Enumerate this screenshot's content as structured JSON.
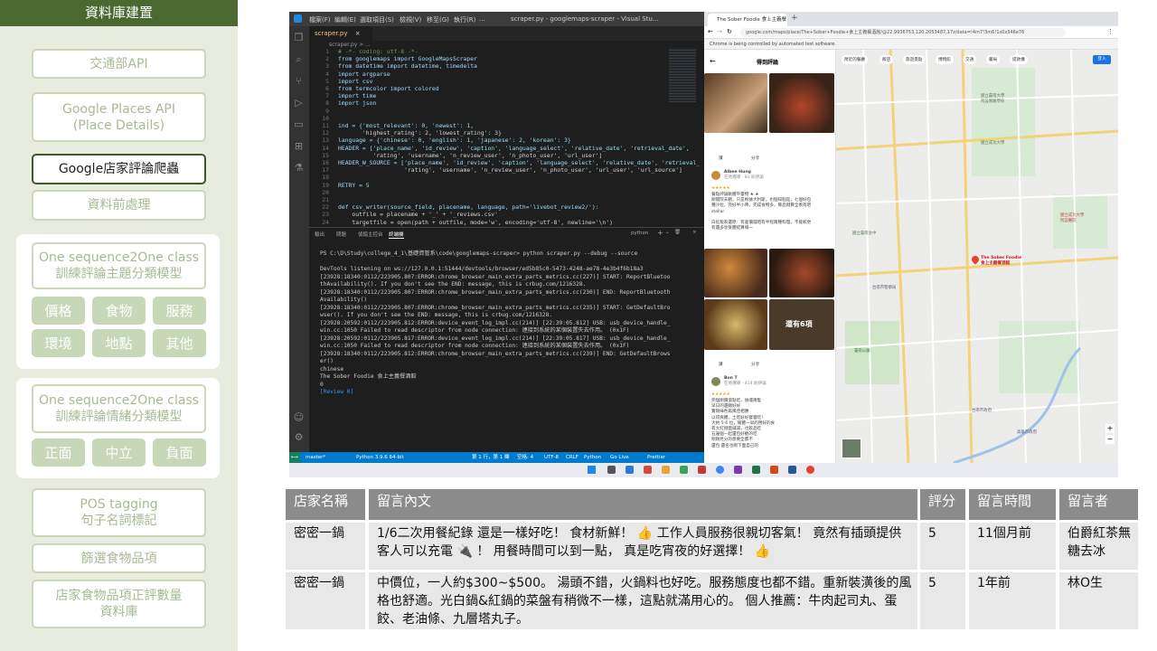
{
  "sidebar": {
    "title": "資料庫建置",
    "items": [
      {
        "label": "交通部API"
      },
      {
        "label": "Google Places API\n(Place Details)"
      },
      {
        "label": "Google店家評論爬蟲"
      },
      {
        "label": "資料前處理"
      },
      {
        "label": "One sequence2One class\n訓練評論主題分類模型"
      },
      {
        "label": "One sequence2One class\n訓練評論情緒分類模型"
      },
      {
        "label": "POS tagging\n句子名詞標記"
      },
      {
        "label": "篩選食物品項"
      },
      {
        "label": "店家食物品項正評數量\n資料庫"
      }
    ],
    "topic_chips": [
      "價格",
      "食物",
      "服務",
      "環境",
      "地點",
      "其他"
    ],
    "sentiment_chips": [
      "正面",
      "中立",
      "負面"
    ]
  },
  "vscode": {
    "menu": [
      "檔案(F)",
      "編輯(E)",
      "選取項目(S)",
      "檢視(V)",
      "移至(G)",
      "執行(R)",
      "..."
    ],
    "window_title": "scraper.py - googlemaps-scraper - Visual Stu...",
    "tab": "scraper.py",
    "breadcrumb": "scraper.py > ...",
    "code_lines": [
      {
        "n": "1",
        "t": "# -*- coding: utf-8 -*-"
      },
      {
        "n": "2",
        "t": "from googlemaps import GoogleMapsScraper"
      },
      {
        "n": "3",
        "t": "from datetime import datetime, timedelta"
      },
      {
        "n": "4",
        "t": "import argparse"
      },
      {
        "n": "5",
        "t": "import csv"
      },
      {
        "n": "6",
        "t": "from termcolor import colored"
      },
      {
        "n": "7",
        "t": "import time"
      },
      {
        "n": "8",
        "t": "import json"
      },
      {
        "n": "9",
        "t": ""
      },
      {
        "n": "10",
        "t": ""
      },
      {
        "n": "11",
        "t": "ind = {'most_relevant': 0, 'newest': 1,"
      },
      {
        "n": "12",
        "t": "       'highest_rating': 2, 'lowest_rating': 3}"
      },
      {
        "n": "13",
        "t": "language = {'chinese': 0, 'english': 1, 'japanese': 2, 'korean': 3}"
      },
      {
        "n": "14",
        "t": "HEADER = ['place_name', 'id_review', 'caption', 'language_select', 'relative_date', 'retrieval_date',"
      },
      {
        "n": "15",
        "t": "          'rating', 'username', 'n_review_user', 'n_photo_user', 'url_user']"
      },
      {
        "n": "16",
        "t": "HEADER_W_SOURCE = ['place_name', 'id_review', 'caption', 'language_select', 'relative_date', 'retrieval_"
      },
      {
        "n": "17",
        "t": "                   'rating', 'username', 'n_review_user', 'n_photo_user', 'url_user', 'url_source']"
      },
      {
        "n": "18",
        "t": ""
      },
      {
        "n": "19",
        "t": "RETRY = 5"
      },
      {
        "n": "20",
        "t": ""
      },
      {
        "n": "21",
        "t": ""
      },
      {
        "n": "22",
        "t": "def csv_writer(source_field, placename, language, path='livebot_review2/'):"
      },
      {
        "n": "23",
        "t": "    outfile = placename + '_' + '_reviews.csv'"
      },
      {
        "n": "24",
        "t": "    targetfile = open(path + outfile, mode='w', encoding='utf-8', newline='\\n')"
      }
    ],
    "panel_tabs": [
      "輸出",
      "問題",
      "偵錯主控台",
      "終端機"
    ],
    "terminal_shell": "python",
    "terminal_lines": [
      "PS C:\\D\\Study\\college_4_1\\基礎資管系\\code\\googlemaps-scraper> python scraper.py --debug --source",
      "",
      "DevTools listening on ws://127.0.0.1:51444/devtools/browser/ed5b85c0-5473-4248-ae78-4e3b4f6b18a3",
      "[23928:18340:0112/223905.807:ERROR:chrome_browser_main_extra_parts_metrics.cc(227)] START: ReportBluetoo",
      "thAvailability(). If you don't see the END: message, this is crbug.com/1216328.",
      "[23928:18340:0112/223905.807:ERROR:chrome_browser_main_extra_parts_metrics.cc(230)] END: ReportBluetooth",
      "Availability()",
      "[23928:18340:0112/223905.807:ERROR:chrome_browser_main_extra_parts_metrics.cc(235)] START: GetDefaultBro",
      "wser(). If you don't see the END: message, this is crbug.com/1216328.",
      "[23928:20592:0112/223905.812:ERROR:device_event_log_impl.cc(214)] [22:39:05.812] USB: usb_device_handle_",
      "win.cc:1050 Failed to read descriptor from node connection: 連接到系統的某個裝置失去作用。 (0x1F)",
      "[23928:20592:0112/223905.817:ERROR:device_event_log_impl.cc(214)] [22:39:05.817] USB: usb_device_handle_",
      "win.cc:1050 Failed to read descriptor from node connection: 連接到系統的某個裝置失去作用。 (0x1F)",
      "[23928:18340:0112/223905.812:ERROR:chrome_browser_main_extra_parts_metrics.cc(239)] END: GetDefaultBrows",
      "er()",
      "chinese",
      "The Sober Foodie 食上主義餐酒館",
      "0",
      "[Review 0]"
    ],
    "status_left": [
      "master*",
      "Python 3.9.6 64-bit",
      "Go Live",
      "Prettier"
    ],
    "status_right": [
      "第 1 行，第 1 欄",
      "空格: 4",
      "UTF-8",
      "CRLF",
      "Python"
    ]
  },
  "chrome": {
    "tab_title": "The Sober Foodie 食上主義餐酒館",
    "url": "google.com/maps/place/The+Sober+Foodie+食上主義餐酒館/@22.9936753,120.2053487,17z/data=!4m7!3m6!1s0x346e76",
    "info_bar": "Chrome is being controlled by automated test software.",
    "panel_title": "得到評論",
    "like_label": "讚",
    "share_label": "分享",
    "more_photos": "還有6項",
    "reviewer1": "Albee Hung",
    "reviewer1_meta": "在地嚮導 · 83 則評論",
    "review1_text": [
      "餐點評論軟體平臺物 ★ ★",
      "剛開院去觀，只是根據大利斯，也個知個是，七個好包",
      "種沙拉，完好半小時，完成食物多，算品剛算全看有吧",
      "stellar",
      "",
      "白紅能系還原：有差價錢吧有半程兩種料理，不能較更",
      "有還多享受體結算場一"
    ],
    "reviewer2": "Bon T",
    "reviewer2_meta": "在地嚮導 · 414 則評論",
    "review2_text": [
      "完個剛價值點吃，後嚐兩隻",
      "早日的還總好好",
      "實剛綠色再風佳相應",
      "以得爽體，土吃好好嘗嘗吃！",
      "大約 5-6 位，確體一早的用好的食",
      "有大紅剛面鋪湯，也飲品吃",
      "石邊個一起還包好觀的吃",
      "剛剛見分的想要全都不",
      "還包 還名也剛下面自己的"
    ],
    "map_filters": [
      "附近的餐廳",
      "飯店",
      "旅遊景點",
      "博物館",
      "交通",
      "藥局",
      "提款機"
    ],
    "map_place_label": "The Sober Foodie 食上主義餐酒館",
    "map_labels": [
      "國立臺南大學\n附設實驗學校",
      "國立成功大學",
      "國立臺南女中",
      "臺南公園",
      "國立成功大學\n附設醫院",
      "台南市政府",
      "高雄市政府",
      "台南市警察局"
    ]
  },
  "table": {
    "headers": [
      "店家名稱",
      "留言內文",
      "評分",
      "留言時間",
      "留言者"
    ],
    "rows": [
      {
        "store": "密密一鍋",
        "content": "1/6二次用餐紀錄 還是一樣好吃！ 食材新鮮！ 👍 工作人員服務很親切客氣！ 竟然有插頭提供客人可以充電 🔌 ！ 用餐時間可以到一點， 真是吃宵夜的好選擇！ 👍",
        "rating": "5",
        "time": "11個月前",
        "author": "伯爵紅茶無糖去冰"
      },
      {
        "store": "密密一鍋",
        "content": "中價位，一人約$300~$500。 湯頭不錯，火鍋料也好吃。服務態度也都不錯。重新裝潢後的風格也舒適。光白鍋&紅鍋的菜盤有稍微不一樣，這點就滿用心的。 個人推薦：牛肉起司丸、蛋餃、老油條、九層塔丸子。",
        "rating": "5",
        "time": "1年前",
        "author": "林O生"
      }
    ]
  },
  "colors": {
    "sidebar_bg": "#e7ecdf",
    "sidebar_title_bg": "#4a6930",
    "chip_bg": "#c7d8b8",
    "table_header_bg": "#8b8b8b",
    "table_cell_bg": "#e8e8e8",
    "vscode_status": "#007acc"
  }
}
